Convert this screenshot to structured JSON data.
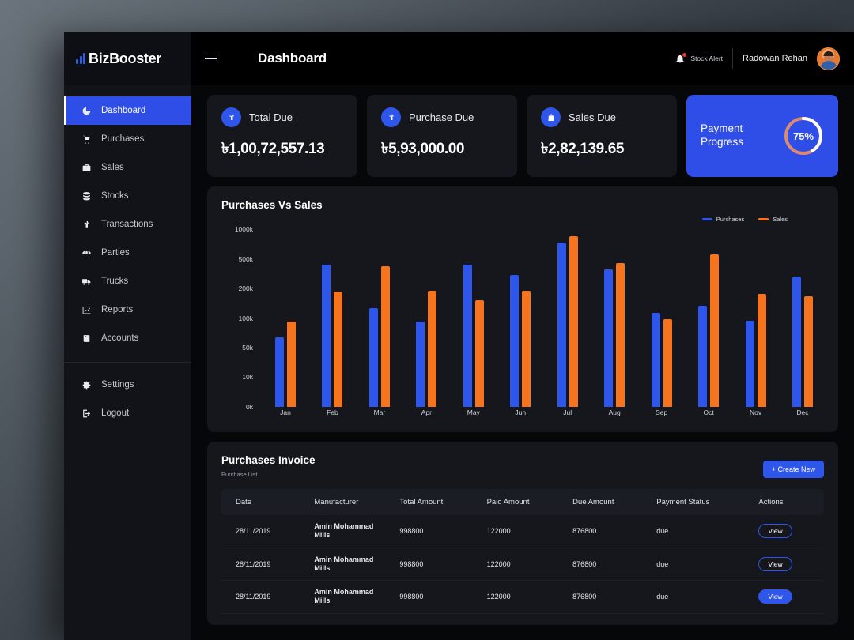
{
  "brand": {
    "name": "BizBooster",
    "mark_icon": "bar-chart-logo-icon"
  },
  "sidebar": {
    "items": [
      {
        "label": "Dashboard",
        "icon": "pie-chart-icon",
        "active": true
      },
      {
        "label": "Purchases",
        "icon": "cart-icon",
        "active": false
      },
      {
        "label": "Sales",
        "icon": "briefcase-icon",
        "active": false
      },
      {
        "label": "Stocks",
        "icon": "database-icon",
        "active": false
      },
      {
        "label": "Transactions",
        "icon": "taka-icon",
        "active": false
      },
      {
        "label": "Parties",
        "icon": "handshake-icon",
        "active": false
      },
      {
        "label": "Trucks",
        "icon": "truck-icon",
        "active": false
      },
      {
        "label": "Reports",
        "icon": "line-chart-icon",
        "active": false
      },
      {
        "label": "Accounts",
        "icon": "book-icon",
        "active": false
      }
    ],
    "footer_items": [
      {
        "label": "Settings",
        "icon": "gear-icon"
      },
      {
        "label": "Logout",
        "icon": "logout-icon"
      }
    ]
  },
  "topbar": {
    "menu_icon": "hamburger-icon",
    "title": "Dashboard",
    "alert_icon": "bell-icon",
    "alert_label": "Stock Alert",
    "user_name": "Radowan Rehan",
    "avatar_icon": "user-avatar"
  },
  "stats": [
    {
      "label": "Total Due",
      "value": "৳1,00,72,557.13",
      "icon": "taka-icon"
    },
    {
      "label": "Purchase Due",
      "value": "৳5,93,000.00",
      "icon": "taka-icon"
    },
    {
      "label": "Sales Due",
      "value": "৳2,82,139.65",
      "icon": "bag-icon"
    }
  ],
  "payment_progress": {
    "label_line1": "Payment",
    "label_line2": "Progress",
    "value_text": "75%",
    "percent": 75,
    "track_color": "#d98a72",
    "arc_color": "#ffffff",
    "card_color": "#2f4ee8"
  },
  "chart_data": {
    "type": "bar",
    "title": "Purchases Vs Sales",
    "xlabel": "",
    "ylabel": "",
    "grid": false,
    "legend_position": "top-right",
    "categories": [
      "Jan",
      "Feb",
      "Mar",
      "Apr",
      "May",
      "Jun",
      "Jul",
      "Aug",
      "Sep",
      "Oct",
      "Nov",
      "Dec"
    ],
    "ytick_labels": [
      "1000k",
      "500k",
      "200k",
      "100k",
      "50k",
      "10k",
      "0k"
    ],
    "ytick_positions": [
      310,
      346,
      382,
      418,
      453,
      489,
      525
    ],
    "series": [
      {
        "name": "Purchases",
        "color": "#2f56ea",
        "values": [
          70,
          500,
          100,
          140,
          500,
          400,
          800,
          440,
          170,
          200,
          140,
          380
        ],
        "pixel_heights": [
          88,
          180,
          125,
          108,
          180,
          167,
          208,
          174,
          119,
          128,
          109,
          165
        ]
      },
      {
        "name": "Sales",
        "color": "#f5741d",
        "values": [
          140,
          300,
          480,
          250,
          180,
          250,
          900,
          520,
          130,
          650,
          240,
          220
        ],
        "pixel_heights": [
          108,
          146,
          178,
          147,
          135,
          147,
          216,
          182,
          111,
          193,
          143,
          140
        ]
      }
    ]
  },
  "invoice": {
    "title": "Purchases Invoice",
    "subtitle": "Purchase List",
    "create_label": "+ Create New",
    "columns": [
      "Date",
      "Manufacturer",
      "Total Amount",
      "Paid Amount",
      "Due Amount",
      "Payment Status",
      "Actions"
    ],
    "rows": [
      {
        "date": "28/11/2019",
        "manufacturer": "Amin Mohammad Mills",
        "total": "998800",
        "paid": "122000",
        "due": "876800",
        "status": "due",
        "action": "View",
        "action_filled": false
      },
      {
        "date": "28/11/2019",
        "manufacturer": "Amin Mohammad Mills",
        "total": "998800",
        "paid": "122000",
        "due": "876800",
        "status": "due",
        "action": "View",
        "action_filled": false
      },
      {
        "date": "28/11/2019",
        "manufacturer": "Amin Mohammad Mills",
        "total": "998800",
        "paid": "122000",
        "due": "876800",
        "status": "due",
        "action": "View",
        "action_filled": true
      }
    ]
  }
}
